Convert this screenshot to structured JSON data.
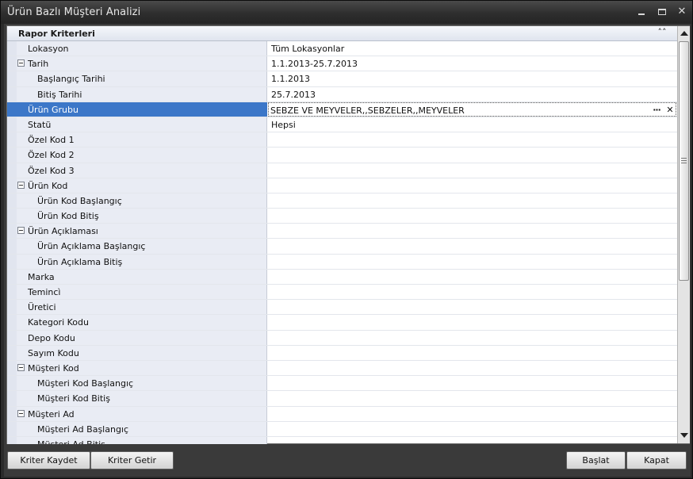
{
  "window": {
    "title": "Ürün Bazlı Müşteri Analizi",
    "controls": {
      "minimize": "minimize-icon",
      "maximize": "maximize-icon",
      "close": "close-icon"
    }
  },
  "category": {
    "label": "Rapor Kriterleri",
    "collapse_icon": "double-chevron-up-icon",
    "collapse_glyph": "˄˄"
  },
  "rows": [
    {
      "label": "Lokasyon",
      "value": "Tüm Lokasyonlar",
      "level": 0,
      "expander": false
    },
    {
      "label": "Tarih",
      "value": "1.1.2013-25.7.2013",
      "level": 0,
      "expander": true
    },
    {
      "label": "Başlangıç Tarihi",
      "value": "1.1.2013",
      "level": 1,
      "expander": false
    },
    {
      "label": "Bitiş Tarihi",
      "value": "25.7.2013",
      "level": 1,
      "expander": false
    },
    {
      "label": "Ürün Grubu",
      "value": "SEBZE VE MEYVELER,,SEBZELER,,MEYVELER",
      "level": 0,
      "expander": false,
      "selected": true
    },
    {
      "label": "Statü",
      "value": "Hepsi",
      "level": 0,
      "expander": false
    },
    {
      "label": "Özel Kod 1",
      "value": "",
      "level": 0,
      "expander": false
    },
    {
      "label": "Özel Kod 2",
      "value": "",
      "level": 0,
      "expander": false
    },
    {
      "label": "Özel Kod 3",
      "value": "",
      "level": 0,
      "expander": false
    },
    {
      "label": "Ürün Kod",
      "value": "",
      "level": 0,
      "expander": true
    },
    {
      "label": "Ürün Kod Başlangıç",
      "value": "",
      "level": 1,
      "expander": false
    },
    {
      "label": "Ürün Kod Bitiş",
      "value": "",
      "level": 1,
      "expander": false
    },
    {
      "label": "Ürün Açıklaması",
      "value": "",
      "level": 0,
      "expander": true
    },
    {
      "label": "Ürün Açıklama Başlangıç",
      "value": "",
      "level": 1,
      "expander": false
    },
    {
      "label": "Ürün Açıklama Bitiş",
      "value": "",
      "level": 1,
      "expander": false
    },
    {
      "label": "Marka",
      "value": "",
      "level": 0,
      "expander": false
    },
    {
      "label": "Temincì",
      "value": "",
      "level": 0,
      "expander": false
    },
    {
      "label": "Üretici",
      "value": "",
      "level": 0,
      "expander": false
    },
    {
      "label": "Kategori Kodu",
      "value": "",
      "level": 0,
      "expander": false
    },
    {
      "label": "Depo Kodu",
      "value": "",
      "level": 0,
      "expander": false
    },
    {
      "label": "Sayım Kodu",
      "value": "",
      "level": 0,
      "expander": false
    },
    {
      "label": "Müşteri Kod",
      "value": "",
      "level": 0,
      "expander": true
    },
    {
      "label": "Müşteri Kod Başlangıç",
      "value": "",
      "level": 1,
      "expander": false
    },
    {
      "label": "Müşteri Kod Bitiş",
      "value": "",
      "level": 1,
      "expander": false
    },
    {
      "label": "Müşteri Ad",
      "value": "",
      "level": 0,
      "expander": true
    },
    {
      "label": "Müşteri Ad Başlangıç",
      "value": "",
      "level": 1,
      "expander": false
    },
    {
      "label": "Müşteri Ad Bitiş",
      "value": "",
      "level": 1,
      "expander": false
    }
  ],
  "editor": {
    "ellipsis": "···",
    "clear": "✕"
  },
  "buttons": {
    "save_criteria": "Kriter Kaydet",
    "load_criteria": "Kriter Getir",
    "start": "Başlat",
    "close": "Kapat"
  },
  "colors": {
    "selection": "#3c77c8",
    "name_column": "#e9ecf4",
    "titlebar": "#2e2e2e"
  }
}
